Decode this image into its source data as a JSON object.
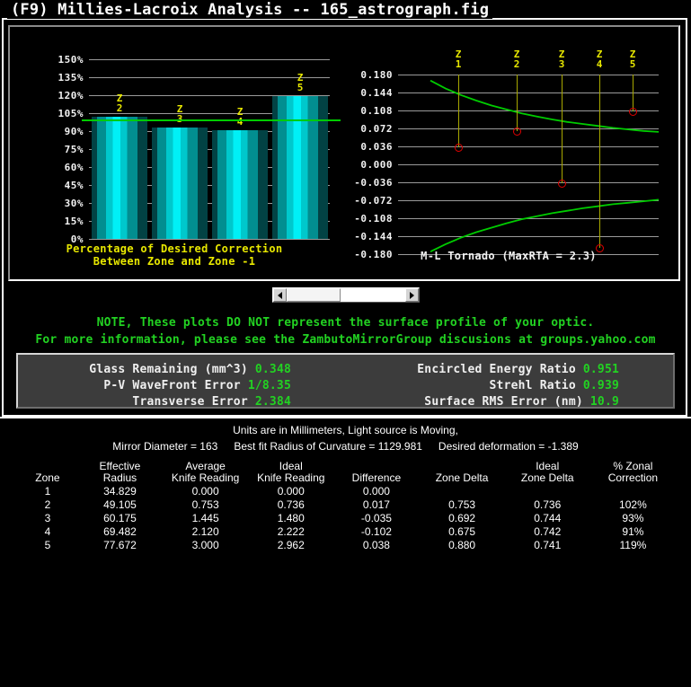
{
  "window": {
    "title": "(F9) Millies-Lacroix Analysis -- 165_astrograph.fig"
  },
  "scrollbar": {
    "left_arrow": "◄",
    "right_arrow": "►"
  },
  "notes": {
    "line1": "NOTE, These plots DO NOT represent the surface profile of your optic.",
    "line2": "For more information, please see the ZambutoMirrorGroup discusions at groups.yahoo.com",
    "color": "#22d222"
  },
  "stats": {
    "left": [
      {
        "label": "Glass Remaining (mm^3)",
        "value": "0.348"
      },
      {
        "label": "P-V WaveFront Error",
        "value": "1/8.35"
      },
      {
        "label": "Transverse Error",
        "value": "2.384"
      }
    ],
    "right": [
      {
        "label": "Encircled Energy Ratio",
        "value": "0.951"
      },
      {
        "label": "Strehl Ratio",
        "value": "0.939"
      },
      {
        "label": "Surface RMS Error (nm)",
        "value": "10.9"
      }
    ],
    "value_color": "#22d222"
  },
  "info": {
    "units_line": "Units are in Millimeters, Light source is Moving,",
    "mirror_diameter": "Mirror Diameter = 163",
    "best_fit_roc": "Best fit Radius of Curvature = 1129.981",
    "desired_deformation": "Desired deformation = -1.389"
  },
  "table": {
    "headers": [
      "Zone",
      "Effective\nRadius",
      "Average\nKnife Reading",
      "Ideal\nKnife Reading",
      "Difference",
      "Zone Delta",
      "Ideal\nZone Delta",
      "% Zonal\nCorrection"
    ],
    "rows": [
      [
        "1",
        "34.829",
        "0.000",
        "0.000",
        "0.000",
        "",
        "",
        ""
      ],
      [
        "2",
        "49.105",
        "0.753",
        "0.736",
        "0.017",
        "0.753",
        "0.736",
        "102%"
      ],
      [
        "3",
        "60.175",
        "1.445",
        "1.480",
        "-0.035",
        "0.692",
        "0.744",
        "93%"
      ],
      [
        "4",
        "69.482",
        "2.120",
        "2.222",
        "-0.102",
        "0.675",
        "0.742",
        "91%"
      ],
      [
        "5",
        "77.672",
        "3.000",
        "2.962",
        "0.038",
        "0.880",
        "0.741",
        "119%"
      ]
    ]
  },
  "chart_data": [
    {
      "type": "bar",
      "id": "percentage-correction",
      "title": "Percentage of Desired Correction",
      "subtitle": "Between Zone and Zone -1",
      "categories": [
        "Z\n2",
        "Z\n3",
        "Z\n4",
        "Z\n5"
      ],
      "values": [
        102,
        93,
        91,
        119
      ],
      "ylabel": "",
      "xlabel": "",
      "ylim": [
        0,
        150
      ],
      "ytick_labels": [
        "150%",
        "135%",
        "120%",
        "105%",
        "90%",
        "75%",
        "60%",
        "45%",
        "30%",
        "15%",
        "0%"
      ],
      "ytick_values": [
        150,
        135,
        120,
        105,
        90,
        75,
        60,
        45,
        30,
        15,
        0
      ],
      "reference_line": 100,
      "reference_line_color": "#00cc00",
      "grid": true,
      "bar_color": "#00c8cc",
      "label_color": "#e8e800"
    },
    {
      "type": "scatter",
      "id": "ml-tornado",
      "title": "M-L Tornado (MaxRTA = 2.3)",
      "ylim": [
        -0.18,
        0.18
      ],
      "ytick_labels": [
        "0.180",
        "0.144",
        "0.108",
        "0.072",
        "0.036",
        "0.000",
        "-0.036",
        "-0.072",
        "-0.108",
        "-0.144",
        "-0.180"
      ],
      "ytick_values": [
        0.18,
        0.144,
        0.108,
        0.072,
        0.036,
        0.0,
        -0.036,
        -0.072,
        -0.108,
        -0.144,
        -0.18
      ],
      "zone_labels": [
        "Z\n1",
        "Z\n2",
        "Z\n3",
        "Z\n4",
        "Z\n5"
      ],
      "zone_x": [
        34.829,
        49.105,
        60.175,
        69.482,
        77.672
      ],
      "marker_values": [
        0.034,
        0.067,
        -0.037,
        -0.167,
        0.107
      ],
      "marker_color": "#e00000",
      "zone_line_color": "#a8a800",
      "envelope_color": "#00cc00",
      "envelope_upper": [
        0.168,
        0.152,
        0.139,
        0.128,
        0.118,
        0.11,
        0.102,
        0.096,
        0.09,
        0.085,
        0.081,
        0.077,
        0.073,
        0.07,
        0.067,
        0.065
      ],
      "envelope_lower": [
        -0.175,
        -0.16,
        -0.147,
        -0.136,
        -0.127,
        -0.118,
        -0.11,
        -0.104,
        -0.098,
        -0.093,
        -0.088,
        -0.084,
        -0.08,
        -0.077,
        -0.074,
        -0.071
      ],
      "grid": true
    }
  ]
}
